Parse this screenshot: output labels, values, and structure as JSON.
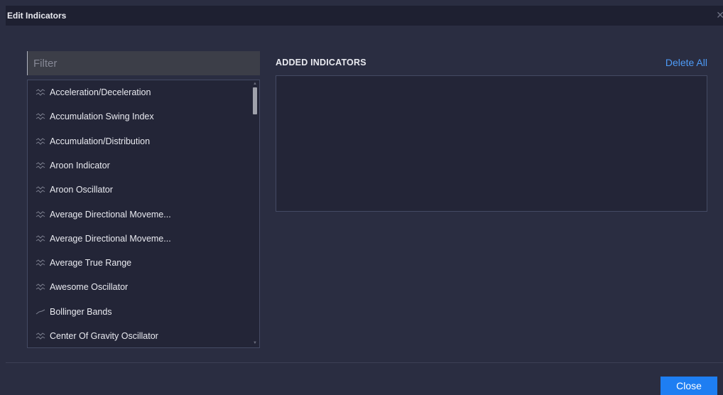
{
  "dialog": {
    "title": "Edit Indicators",
    "close_icon": "close-icon"
  },
  "filter": {
    "placeholder": "Filter",
    "value": ""
  },
  "indicators": [
    {
      "label": "Acceleration/Deceleration",
      "icon": "dual-line-chart-icon"
    },
    {
      "label": "Accumulation Swing Index",
      "icon": "dual-line-chart-icon"
    },
    {
      "label": "Accumulation/Distribution",
      "icon": "dual-line-chart-icon"
    },
    {
      "label": "Aroon Indicator",
      "icon": "dual-line-chart-icon"
    },
    {
      "label": "Aroon Oscillator",
      "icon": "dual-line-chart-icon"
    },
    {
      "label": "Average Directional Moveme...",
      "icon": "dual-line-chart-icon"
    },
    {
      "label": "Average Directional Moveme...",
      "icon": "dual-line-chart-icon"
    },
    {
      "label": "Average True Range",
      "icon": "dual-line-chart-icon"
    },
    {
      "label": "Awesome Oscillator",
      "icon": "dual-line-chart-icon"
    },
    {
      "label": "Bollinger Bands",
      "icon": "single-line-chart-icon"
    },
    {
      "label": "Center Of Gravity Oscillator",
      "icon": "dual-line-chart-icon"
    }
  ],
  "added": {
    "heading": "ADDED INDICATORS",
    "delete_all_label": "Delete All",
    "items": []
  },
  "footer": {
    "close_label": "Close"
  },
  "colors": {
    "background": "#2a2d41",
    "titlebar": "#1e2031",
    "panel": "#232537",
    "accent": "#1e7ef2",
    "link": "#4e9bf7"
  }
}
